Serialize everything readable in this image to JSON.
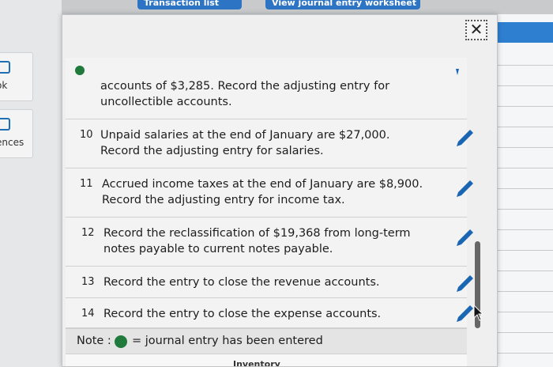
{
  "sidebar": {
    "ebook_label": "ok",
    "references_label": "ences"
  },
  "top_tabs": {
    "tab1": "Transaction list",
    "tab2": "View journal entry worksheet"
  },
  "modal": {
    "close_label": "✕",
    "rows": [
      {
        "num": "",
        "text": "accounts of $3,285. Record the adjusting entry for uncollectible accounts."
      },
      {
        "num": "10",
        "text": "Unpaid salaries at the end of January are $27,000. Record the adjusting entry for salaries."
      },
      {
        "num": "11",
        "text": "Accrued income taxes at the end of January are $8,900. Record the adjusting entry for income tax."
      },
      {
        "num": "12",
        "text": "Record the reclassification of $19,368 from long-term notes payable to current notes payable."
      },
      {
        "num": "13",
        "text": "Record the entry to close the revenue accounts."
      },
      {
        "num": "14",
        "text": "Record the entry to close the expense accounts."
      }
    ],
    "note_label": "Note :",
    "note_text": "= journal entry has been entered",
    "bottom_tab": "Inventory"
  },
  "colors": {
    "accent_blue": "#2d74c4",
    "entered_green": "#1f7a3b"
  },
  "icons": {
    "edit": "pencil-icon",
    "close": "close-icon",
    "status": "entered-dot-icon"
  }
}
